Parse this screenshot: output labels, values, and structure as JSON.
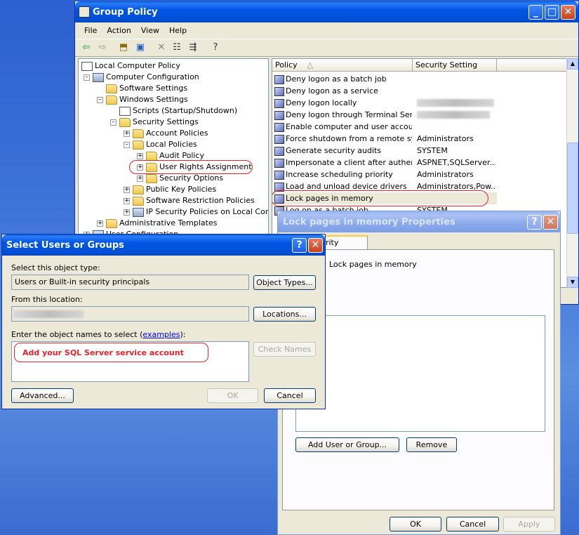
{
  "group_policy": {
    "title": "Group Policy",
    "menu": [
      "File",
      "Action",
      "View",
      "Help"
    ],
    "tree": [
      {
        "label": "Local Computer Policy",
        "icon": "policy-icon"
      },
      {
        "label": "Computer Configuration",
        "icon": "computer-icon"
      },
      {
        "label": "Software Settings",
        "icon": "folder-icon"
      },
      {
        "label": "Windows Settings",
        "icon": "folder-icon"
      },
      {
        "label": "Scripts (Startup/Shutdown)",
        "icon": "script-icon"
      },
      {
        "label": "Security Settings",
        "icon": "security-folder-icon"
      },
      {
        "label": "Account Policies",
        "icon": "security-folder-icon"
      },
      {
        "label": "Local Policies",
        "icon": "security-folder-icon"
      },
      {
        "label": "Audit Policy",
        "icon": "security-folder-icon"
      },
      {
        "label": "User Rights Assignment",
        "icon": "security-folder-icon"
      },
      {
        "label": "Security Options",
        "icon": "security-folder-icon"
      },
      {
        "label": "Public Key Policies",
        "icon": "folder-icon"
      },
      {
        "label": "Software Restriction Policies",
        "icon": "folder-icon"
      },
      {
        "label": "IP Security Policies on Local Comput",
        "icon": "ipsec-icon"
      },
      {
        "label": "Administrative Templates",
        "icon": "folder-icon"
      },
      {
        "label": "User Configuration",
        "icon": "user-icon"
      }
    ],
    "columns": [
      "Policy",
      "Security Setting"
    ],
    "rows": [
      {
        "policy": "Deny logon as a batch job",
        "setting": ""
      },
      {
        "policy": "Deny logon as a service",
        "setting": ""
      },
      {
        "policy": "Deny logon locally",
        "setting": ""
      },
      {
        "policy": "Deny logon through Terminal Servi...",
        "setting": ""
      },
      {
        "policy": "Enable computer and user account...",
        "setting": ""
      },
      {
        "policy": "Force shutdown from a remote sy...",
        "setting": "Administrators"
      },
      {
        "policy": "Generate security audits",
        "setting": "SYSTEM"
      },
      {
        "policy": "Impersonate a client after authent...",
        "setting": "ASPNET,SQLServer..."
      },
      {
        "policy": "Increase scheduling priority",
        "setting": "Administrators"
      },
      {
        "policy": "Load and unload device drivers",
        "setting": "Administrators,Pow..."
      },
      {
        "policy": "Lock pages in memory",
        "setting": ""
      },
      {
        "policy": "Log on as a batch job",
        "setting": "SYSTEM"
      }
    ]
  },
  "properties": {
    "title": "Lock pages in memory Properties",
    "tab": "Local Security Setting",
    "tab_visible": "urity Setting",
    "policy_name": "Lock pages in memory",
    "add_button": "Add User or Group...",
    "remove_button": "Remove",
    "ok": "OK",
    "cancel": "Cancel",
    "apply": "Apply"
  },
  "select_dialog": {
    "title": "Select Users or Groups",
    "object_type_label": "Select this object type:",
    "object_type_value": "Users or Built-in security principals",
    "object_types_button": "Object Types...",
    "location_label": "From this location:",
    "locations_button": "Locations...",
    "names_label_prefix": "Enter the object names to select (",
    "names_label_link": "examples",
    "names_label_suffix": "):",
    "annotation": "Add your SQL Server service account",
    "check_names_button": "Check Names",
    "advanced_button": "Advanced...",
    "ok": "OK",
    "cancel": "Cancel"
  },
  "colors": {
    "annotation_red": "#e0242a",
    "xp_blue": "#0054e3",
    "face": "#ece9d8"
  }
}
